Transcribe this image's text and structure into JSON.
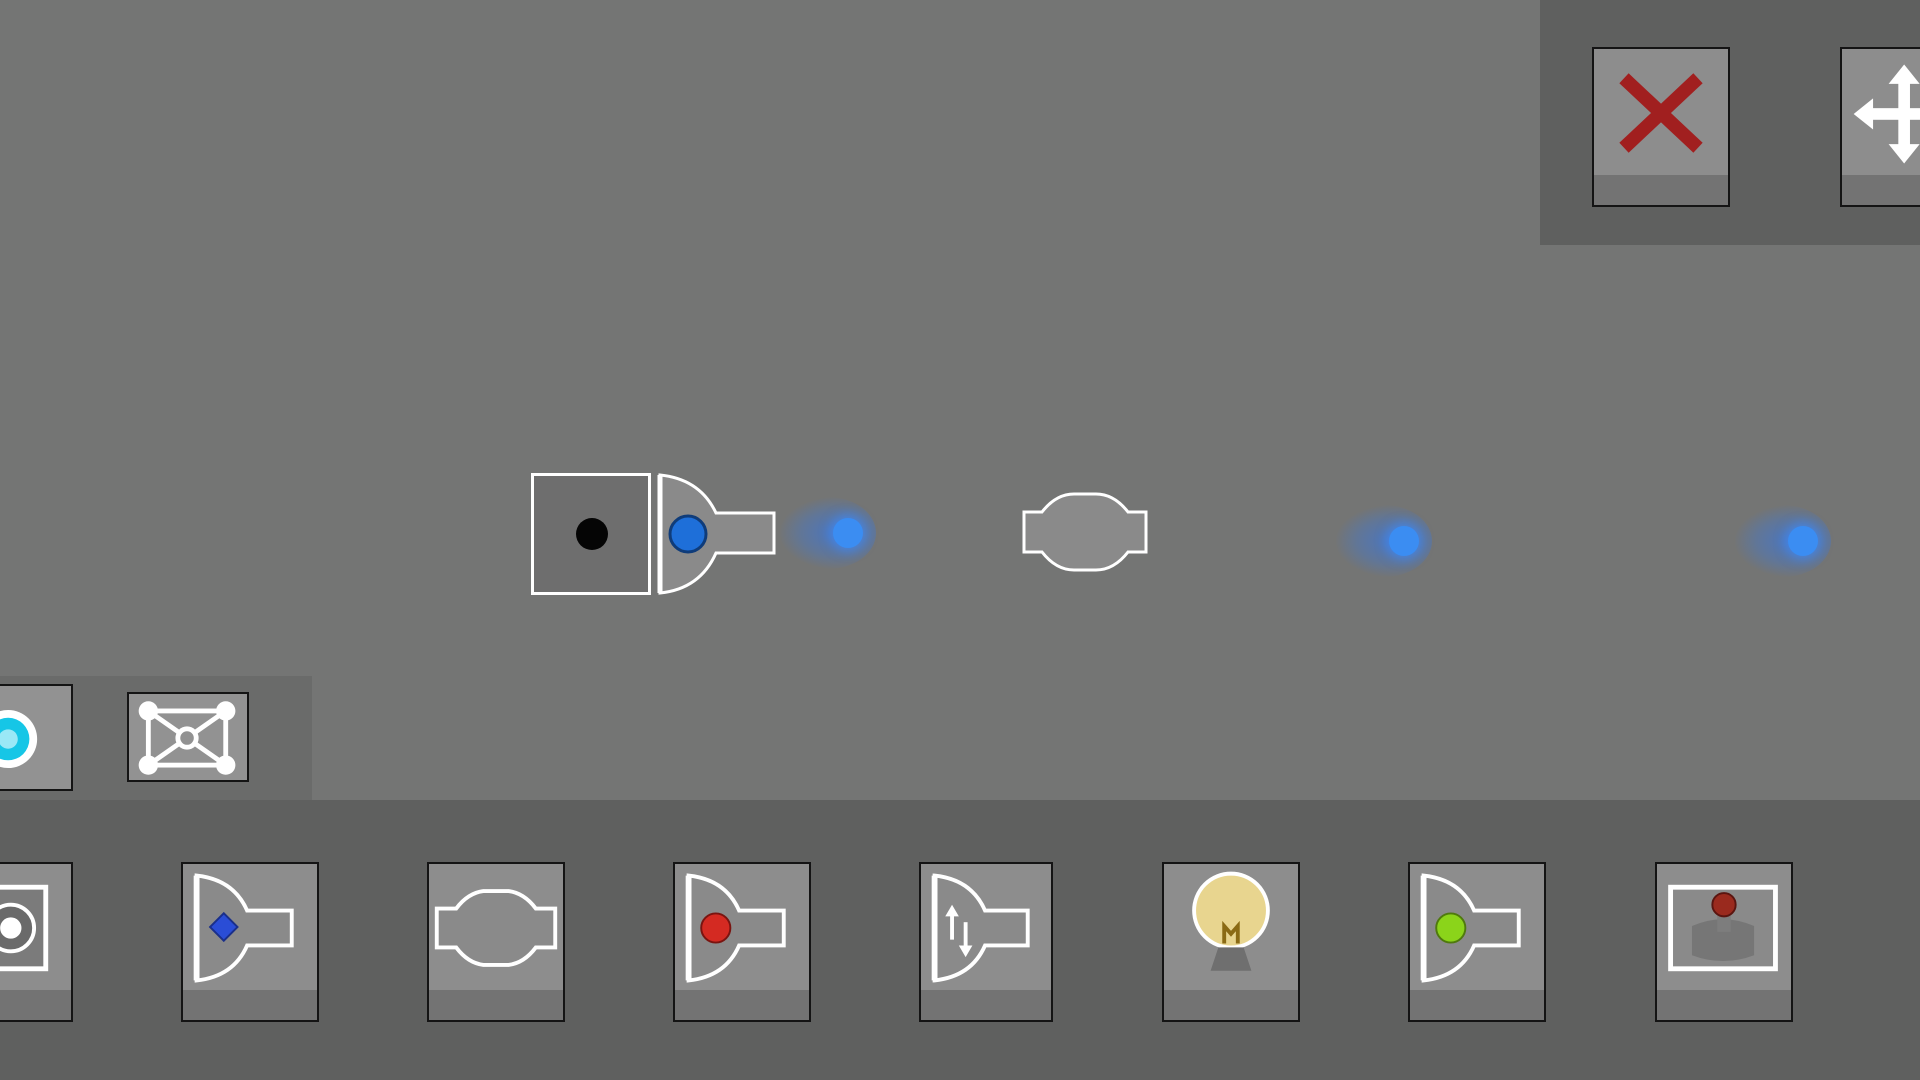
{
  "toolbar_top": {
    "buttons": [
      {
        "id": "delete",
        "icon": "close-icon"
      },
      {
        "id": "move",
        "icon": "move-arrows-icon"
      }
    ]
  },
  "mini_toolbar": {
    "buttons": [
      {
        "id": "portal",
        "icon": "cyan-ring-icon"
      },
      {
        "id": "frame",
        "icon": "node-frame-icon"
      }
    ]
  },
  "palette": {
    "items": [
      {
        "id": "sensor",
        "icon": "sensor-block-icon"
      },
      {
        "id": "blue-emitter",
        "icon": "blue-emitter-icon"
      },
      {
        "id": "connector",
        "icon": "connector-icon"
      },
      {
        "id": "red-emitter",
        "icon": "red-emitter-icon"
      },
      {
        "id": "up-down-emitter",
        "icon": "up-down-emitter-icon"
      },
      {
        "id": "light-bulb",
        "icon": "light-bulb-icon"
      },
      {
        "id": "green-emitter",
        "icon": "green-emitter-icon"
      },
      {
        "id": "joystick",
        "icon": "joystick-icon"
      }
    ]
  },
  "colors": {
    "background": "#747574",
    "panel": "#5f605f",
    "slot": "#8d8d8d",
    "slot_footer": "#737373",
    "close_red": "#a11f1f",
    "emitter_blue": "#1e6fd9",
    "emitter_red": "#d42a22",
    "emitter_green": "#8bd41a",
    "particle_blue": "#3b8df2",
    "cyan": "#16c6e6",
    "bulb_yellow": "#e8d58f"
  }
}
